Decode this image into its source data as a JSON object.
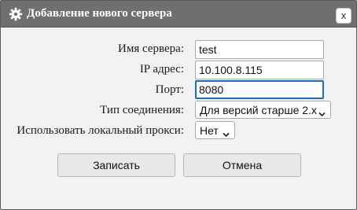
{
  "dialog": {
    "title": "Добавление нового сервера",
    "close_label": "x"
  },
  "form": {
    "server_name": {
      "label": "Имя сервера:",
      "value": "test"
    },
    "ip_address": {
      "label": "IP адрес:",
      "value": "10.100.8.115"
    },
    "port": {
      "label": "Порт:",
      "value": "8080"
    },
    "connection_type": {
      "label": "Тип соединения:",
      "selected": "Для версий старше 2.x"
    },
    "local_proxy": {
      "label": "Использовать локальный прокси:",
      "selected": "Нет"
    }
  },
  "buttons": {
    "save_label": "Записать",
    "cancel_label": "Отмена"
  },
  "icons": {
    "title": "gear-icon",
    "close": "close-icon",
    "dropdown": "chevron-down-icon"
  },
  "colors": {
    "titlebar": "#6f6f6f",
    "focus_border": "#1a6fc4",
    "dialog_background": "#f2f2f2"
  }
}
